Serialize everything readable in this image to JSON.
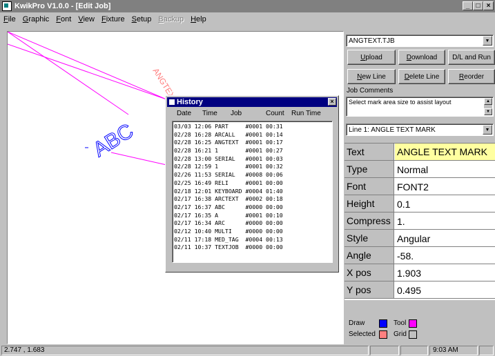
{
  "window": {
    "title": "KwikPro  V1.0.0 - [Edit Job]",
    "min": "_",
    "max": "□",
    "close": "×"
  },
  "menu": [
    {
      "label": "File",
      "key": "F",
      "rest": "ile",
      "disabled": false
    },
    {
      "label": "Graphic",
      "key": "G",
      "rest": "raphic",
      "disabled": false
    },
    {
      "label": "Font",
      "key": "F",
      "rest": "ont",
      "disabled": false
    },
    {
      "label": "View",
      "key": "V",
      "rest": "iew",
      "disabled": false
    },
    {
      "label": "Fixture",
      "key": "F",
      "rest": "ixture",
      "disabled": false
    },
    {
      "label": "Setup",
      "key": "S",
      "rest": "etup",
      "disabled": false
    },
    {
      "label": "Backup",
      "key": "B",
      "rest": "ackup",
      "disabled": true
    },
    {
      "label": "Help",
      "key": "H",
      "rest": "elp",
      "disabled": false
    }
  ],
  "canvas": {
    "text_mark": "ABC",
    "rotated_text": "ANGTEXT",
    "colors": {
      "draw": "#0000ff",
      "tool": "#ff00ff",
      "selected": "#ff8080",
      "grid": "#c0c0c0"
    }
  },
  "panel": {
    "job_file": "ANGTEXT.TJB",
    "buttons": {
      "upload": {
        "key": "U",
        "rest": "pload"
      },
      "download": {
        "key": "D",
        "rest": "ownload"
      },
      "dl_run": "D/L and Run",
      "new_line": {
        "key": "N",
        "rest": "ew Line"
      },
      "delete_line": {
        "key": "D",
        "rest": "elete Line"
      },
      "reorder": {
        "key": "R",
        "rest": "eorder"
      }
    },
    "job_comments_label": "Job Comments",
    "job_comments_text": "Select mark area size to assist layout",
    "line_select": "Line 1: ANGLE TEXT MARK",
    "properties": [
      {
        "name": "Text",
        "value": "ANGLE TEXT MARK"
      },
      {
        "name": "Type",
        "value": "Normal"
      },
      {
        "name": "Font",
        "value": "FONT2"
      },
      {
        "name": "Height",
        "value": "0.1"
      },
      {
        "name": "Compress",
        "value": "1."
      },
      {
        "name": "Style",
        "value": "Angular"
      },
      {
        "name": "Angle",
        "value": "-58."
      },
      {
        "name": "X pos",
        "value": "1.903"
      },
      {
        "name": "Y pos",
        "value": "0.495"
      }
    ],
    "legend": {
      "draw": "Draw",
      "tool": "Tool",
      "selected": "Selected",
      "grid": "Grid"
    }
  },
  "history": {
    "title": "History",
    "columns": [
      "Date",
      "Time",
      "Job",
      "Count",
      "Run Time"
    ],
    "rows": [
      [
        "03/03",
        "12:06",
        "PART",
        "#0001",
        "00:31"
      ],
      [
        "02/28",
        "16:28",
        "ARCALL",
        "#0001",
        "00:14"
      ],
      [
        "02/28",
        "16:25",
        "ANGTEXT",
        "#0001",
        "00:17"
      ],
      [
        "02/28",
        "16:21",
        "1",
        "#0001",
        "00:27"
      ],
      [
        "02/28",
        "13:00",
        "SERIAL",
        "#0001",
        "00:03"
      ],
      [
        "02/28",
        "12:59",
        "1",
        "#0001",
        "00:32"
      ],
      [
        "02/26",
        "11:53",
        "SERIAL",
        "#0008",
        "00:06"
      ],
      [
        "02/25",
        "16:49",
        "RELI",
        "#0001",
        "00:00"
      ],
      [
        "02/18",
        "12:01",
        "KEYBOARD",
        "#0004",
        "01:40"
      ],
      [
        "02/17",
        "16:38",
        "ARCTEXT",
        "#0002",
        "00:18"
      ],
      [
        "02/17",
        "16:37",
        "ABC",
        "#0000",
        "00:00"
      ],
      [
        "02/17",
        "16:35",
        "A",
        "#0001",
        "00:10"
      ],
      [
        "02/17",
        "16:34",
        "ARC",
        "#0000",
        "00:00"
      ],
      [
        "02/12",
        "10:40",
        "MULTI",
        "#0000",
        "00:00"
      ],
      [
        "02/11",
        "17:18",
        "MED_TAG",
        "#0004",
        "00:13"
      ],
      [
        "02/11",
        "10:37",
        "TEXTJOB",
        "#0000",
        "00:00"
      ]
    ]
  },
  "status": {
    "coords": "2.747 , 1.683",
    "time": "9:03 AM"
  }
}
